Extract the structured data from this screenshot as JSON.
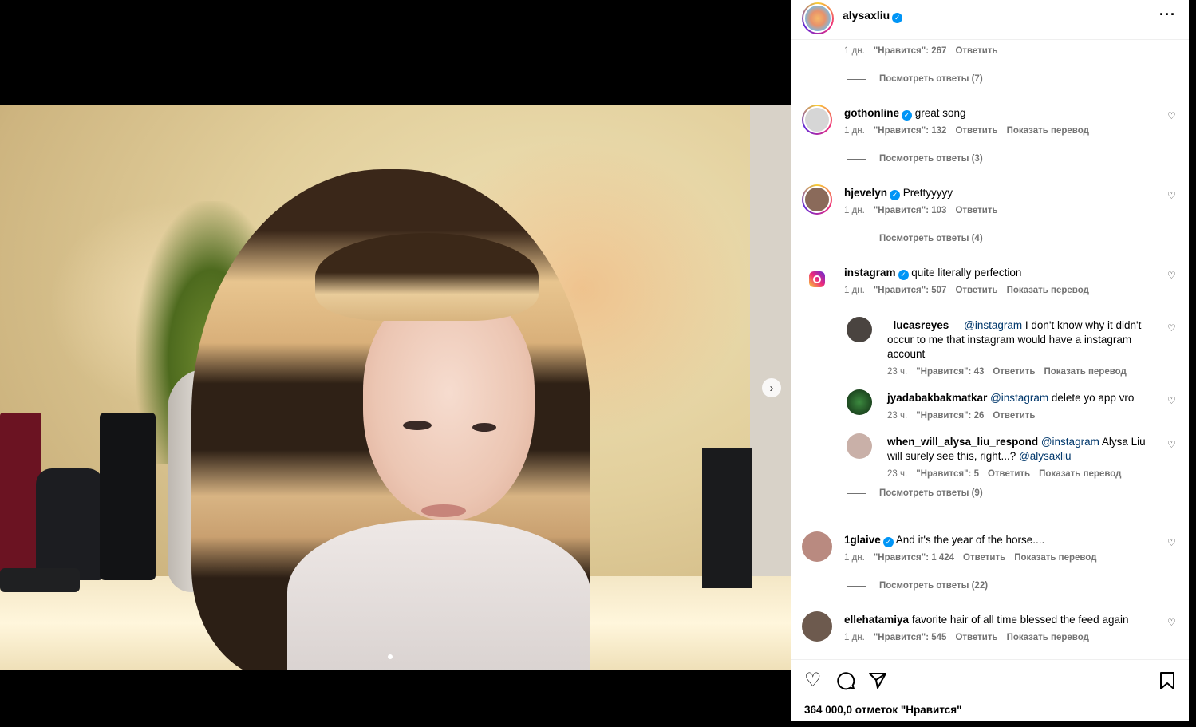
{
  "post": {
    "username": "alysaxliu",
    "more_icon": "more-options-icon",
    "likes": "364 000,0 отметок \"Нравится\""
  },
  "media": {
    "next_icon": "›",
    "slides": 2,
    "active_slide": 0
  },
  "top_partial": {
    "time": "1 дн.",
    "likes": "\"Нравится\": 267",
    "reply": "Ответить",
    "view_replies": "Посмотреть ответы (7)"
  },
  "comments": [
    {
      "username": "gothonline",
      "verified": true,
      "text": "great song",
      "time": "1 дн.",
      "likes": "\"Нравится\": 132",
      "reply": "Ответить",
      "translate": "Показать перевод",
      "view_replies": "Посмотреть ответы (3)",
      "avatar_color": "#cfcfcf"
    },
    {
      "username": "hjevelyn",
      "verified": true,
      "text": "Prettyyyyy",
      "time": "1 дн.",
      "likes": "\"Нравится\": 103",
      "reply": "Ответить",
      "translate": "",
      "view_replies": "Посмотреть ответы (4)",
      "avatar_color": "#8a6a5a"
    },
    {
      "username": "instagram",
      "verified": true,
      "text": "quite literally perfection",
      "time": "1 дн.",
      "likes": "\"Нравится\": 507",
      "reply": "Ответить",
      "translate": "Показать перевод",
      "avatar_color": "#e1306c"
    },
    {
      "username": "1glaive",
      "verified": true,
      "text": "And it's the year of the horse....",
      "time": "1 дн.",
      "likes": "\"Нравится\": 1 424",
      "reply": "Ответить",
      "translate": "Показать перевод",
      "view_replies": "Посмотреть ответы (22)",
      "avatar_color": "#b98a80"
    },
    {
      "username": "ellehatamiya",
      "verified": false,
      "text": "favorite hair of all time blessed the feed again",
      "time": "1 дн.",
      "likes": "\"Нравится\": 545",
      "reply": "Ответить",
      "translate": "Показать перевод",
      "avatar_color": "#6d5a4e"
    }
  ],
  "replies": [
    {
      "username": "_lucasreyes__",
      "mention": "@instagram",
      "text": "I don't know why it didn't occur to me that instagram would have a instagram account",
      "time": "23 ч.",
      "likes": "\"Нравится\": 43",
      "reply": "Ответить",
      "translate": "Показать перевод",
      "avatar_color": "#4a4440"
    },
    {
      "username": "jyadabakbakmatkar",
      "mention": "@instagram",
      "text": "delete yo app vro",
      "time": "23 ч.",
      "likes": "\"Нравится\": 26",
      "reply": "Ответить",
      "translate": "",
      "avatar_color": "#1f4a22"
    },
    {
      "username": "when_will_alysa_liu_respond",
      "mention": "@instagram",
      "text": "Alysa Liu will surely see this, right...?",
      "mention2": "@alysaxliu",
      "time": "23 ч.",
      "likes": "\"Нравится\": 5",
      "reply": "Ответить",
      "translate": "Показать перевод",
      "avatar_color": "#c9b0a8"
    }
  ],
  "instagram_view_replies": "Посмотреть ответы (9)",
  "actions": {
    "like_icon": "heart-icon",
    "comment_icon": "comment-icon",
    "share_icon": "share-icon",
    "save_icon": "bookmark-icon"
  }
}
